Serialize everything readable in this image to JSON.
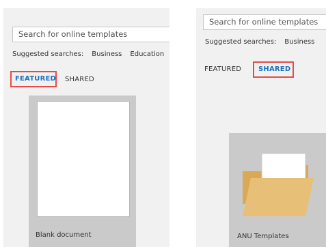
{
  "left_panel": {
    "search": {
      "placeholder": "Search for online templates"
    },
    "suggested": {
      "label": "Suggested searches:",
      "items": [
        "Business",
        "Education"
      ]
    },
    "tabs": [
      {
        "label": "FEATURED",
        "active": true
      },
      {
        "label": "SHARED",
        "active": false
      }
    ],
    "template": {
      "label": "Blank document"
    }
  },
  "right_panel": {
    "search": {
      "placeholder": "Search for online templates"
    },
    "suggested": {
      "label": "Suggested searches:",
      "items": [
        "Business"
      ]
    },
    "tabs": [
      {
        "label": "FEATURED",
        "active": false
      },
      {
        "label": "SHARED",
        "active": true
      }
    ],
    "template": {
      "label": "ANU Templates",
      "icon": "folder-icon"
    }
  },
  "colors": {
    "accent": "#1a72c1",
    "highlight": "#e84a4a",
    "panel_bg": "#f1f1f1",
    "tile_bg": "#cacaca",
    "folder": "#e8bf76"
  }
}
